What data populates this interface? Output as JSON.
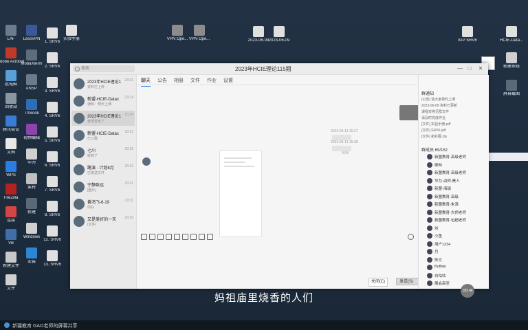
{
  "desktop_icons_left": [
    {
      "label": "LAF",
      "color": "#6a7c8e"
    },
    {
      "label": "Adobe Acrobat DC",
      "color": "#c0392b"
    },
    {
      "label": "此电脑",
      "color": "#5aa0d8"
    },
    {
      "label": "回收站",
      "color": "#8a96a2"
    },
    {
      "label": "腾讯会议",
      "color": "#3a7bd5"
    },
    {
      "label": "文档",
      "color": "#e8e8e8"
    },
    {
      "label": "WPS",
      "color": "#2a7de1"
    },
    {
      "label": "FileZilla",
      "color": "#b22222"
    },
    {
      "label": "连接",
      "color": "#d64545"
    },
    {
      "label": "VB",
      "color": "#3f6ea8"
    },
    {
      "label": "新建文件",
      "color": "#c8c8c8"
    },
    {
      "label": "文件",
      "color": "#d0d0d0"
    }
  ],
  "desktop_icons_col2": [
    {
      "label": "LessVPN",
      "color": "#3b5998"
    },
    {
      "label": "MobaXterm",
      "color": "#5d6d7e"
    },
    {
      "label": "eNSP",
      "color": "#6c7a89"
    },
    {
      "label": "TXBook",
      "color": "#2d6fb6"
    },
    {
      "label": "视频编辑",
      "color": "#8e44ad"
    },
    {
      "label": "华为",
      "color": "#d0d0d0"
    },
    {
      "label": "素材",
      "color": "#c0c0c0"
    },
    {
      "label": "新建",
      "color": "#5a6878"
    },
    {
      "label": "Windows",
      "color": "#d0d0d0"
    },
    {
      "label": "安装",
      "color": "#2b87d6"
    }
  ],
  "desktop_icons_col3": [
    {
      "label": "1. SRV6",
      "color": "#e0e0e0"
    },
    {
      "label": "2. SRV6",
      "color": "#e0e0e0"
    },
    {
      "label": "3. SRV6",
      "color": "#e0e0e0"
    },
    {
      "label": "4. SRV6",
      "color": "#e0e0e0"
    },
    {
      "label": "5. SRV6",
      "color": "#e0e0e0"
    },
    {
      "label": "6. SRV6",
      "color": "#e0e0e0"
    },
    {
      "label": "7. SRV6",
      "color": "#e0e0e0"
    },
    {
      "label": "8. SRV6",
      "color": "#e0e0e0"
    },
    {
      "label": "12. SRV6",
      "color": "#e0e0e0"
    },
    {
      "label": "13. SRV6",
      "color": "#e0e0e0"
    }
  ],
  "desktop_icons_top": [
    {
      "label": "实验手册",
      "color": "#e0e0e0"
    },
    {
      "label": "VPN Ope...",
      "color": "#8c8c8c"
    },
    {
      "label": "VPN Ope...",
      "color": "#8c8c8c"
    },
    {
      "label": "2023-06-09",
      "color": "#e0e0e0"
    },
    {
      "label": "2023-06-09",
      "color": "#e0e0e0"
    },
    {
      "label": "IGP SRV6",
      "color": "#e0e0e0"
    },
    {
      "label": "HCIE-Data...",
      "color": "#e0e0e0"
    },
    {
      "label": "新建系统",
      "color": "#d0d0d0"
    },
    {
      "label": "屏幕截图",
      "color": "#5a6a7a"
    }
  ],
  "taskbar": {
    "text": "新疆教育 GAO老师的屏幕共享"
  },
  "window": {
    "title": "2023年HCIE理论115期",
    "search_placeholder": "搜索",
    "controls": [
      "—",
      "□",
      "✕"
    ]
  },
  "chats": [
    {
      "name": "2023年HCIE理论1",
      "msg": "资料已上传",
      "time": "23:31"
    },
    {
      "name": "新盟-HCIE-Datac",
      "msg": "通知：明天上课",
      "time": "23:14"
    },
    {
      "name": "2023年HCIE理论1",
      "msg": "老师发布了",
      "time": "23:14"
    },
    {
      "name": "新盟-HCIE-Datac",
      "msg": "已入群",
      "time": "23:13"
    },
    {
      "name": "七川",
      "msg": "收到了",
      "time": "23:16"
    },
    {
      "name": "路演 · 计划8月",
      "msg": "已发送文件",
      "time": "23:13"
    },
    {
      "name": "宁静致远",
      "msg": "[图片]",
      "time": "23:12"
    },
    {
      "name": "黄鸿飞-6-19",
      "msg": "你好",
      "time": "23:11"
    },
    {
      "name": "又是美好的一天",
      "msg": "[文件]",
      "time": "23:10"
    }
  ],
  "tabs": [
    "聊天",
    "公告",
    "相册",
    "文件",
    "作业",
    "设置"
  ],
  "system_messages": [
    "2023-06-13 15:27",
    "2023-06-13 15:28",
    "9:04"
  ],
  "buttons": {
    "close": "关闭(C)",
    "send": "发送(S)"
  },
  "right_panel": {
    "notice_title": "群通知",
    "notices": [
      "[公告] 请大家按时上课",
      "2023-06-09 资料已更新",
      "课程安排见群文件",
      "请及时完成作业",
      "[文件] 实验手册.pdf",
      "[文件] SRV6.pdf",
      "[文件] 拓扑图.zip"
    ],
    "members_title": "群成员 69/152",
    "members": [
      "新盟教育-高级老师",
      "柳林",
      "新盟教育-高级老师",
      "华为-讲师-黑人",
      "新盟-海瑞",
      "新盟教育-高级",
      "新盟教育-朱涛",
      "新盟教育-大师老师",
      "新盟教育-包超老师",
      "刘",
      "小鱼",
      "用户1234",
      "月",
      "陈文",
      "Buffalo",
      "白咕咕",
      "展会高至"
    ]
  },
  "subtitle": "妈祖庙里烧香的人们",
  "float_avatar": "183.4k"
}
